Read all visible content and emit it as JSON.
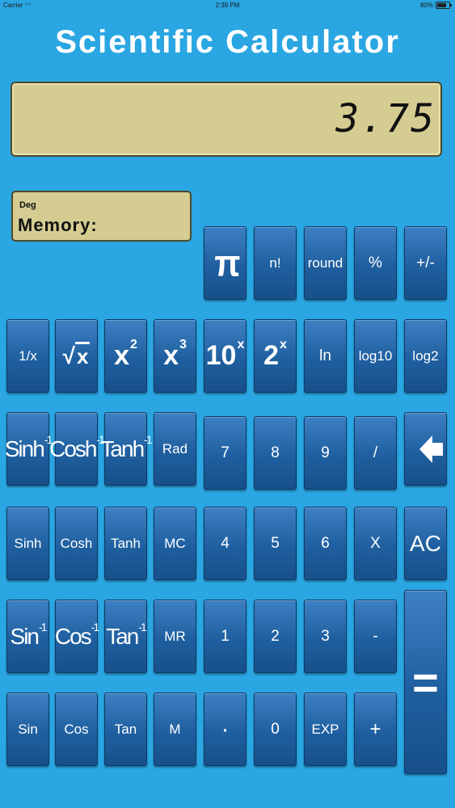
{
  "status_bar": {
    "carrier": "Carrier",
    "time": "2:39 PM",
    "battery": "80%"
  },
  "app": {
    "title": "Scientific Calculator"
  },
  "display": {
    "value": "3.75"
  },
  "memory_panel": {
    "mode": "Deg",
    "label": "Memory:"
  },
  "keys": {
    "pi": "π",
    "factorial": "n!",
    "round": "round",
    "percent": "%",
    "plus_minus": "+/-",
    "reciprocal": "1/x",
    "sqrt": "x",
    "square": {
      "base": "x",
      "exp": "2"
    },
    "cube": {
      "base": "x",
      "exp": "3"
    },
    "ten_pow": {
      "base": "10",
      "exp": "x"
    },
    "two_pow": {
      "base": "2",
      "exp": "x"
    },
    "ln": "ln",
    "log10": "log10",
    "log2": "log2",
    "asinh": {
      "base": "Sinh",
      "exp": "-1"
    },
    "acosh": {
      "base": "Cosh",
      "exp": "-1"
    },
    "atanh": {
      "base": "Tanh",
      "exp": "-1"
    },
    "rad": "Rad",
    "d7": "7",
    "d8": "8",
    "d9": "9",
    "divide": "/",
    "sinh": "Sinh",
    "cosh": "Cosh",
    "tanh": "Tanh",
    "mc": "MC",
    "d4": "4",
    "d5": "5",
    "d6": "6",
    "multiply": "X",
    "ac": "AC",
    "asin": {
      "base": "Sin",
      "exp": "-1"
    },
    "acos": {
      "base": "Cos",
      "exp": "-1"
    },
    "atan": {
      "base": "Tan",
      "exp": "-1"
    },
    "mr": "MR",
    "d1": "1",
    "d2": "2",
    "d3": "3",
    "minus": "-",
    "equals": "=",
    "sin": "Sin",
    "cos": "Cos",
    "tan": "Tan",
    "m": "M",
    "decimal": "·",
    "d0": "0",
    "exp": "EXP",
    "plus": "+"
  }
}
